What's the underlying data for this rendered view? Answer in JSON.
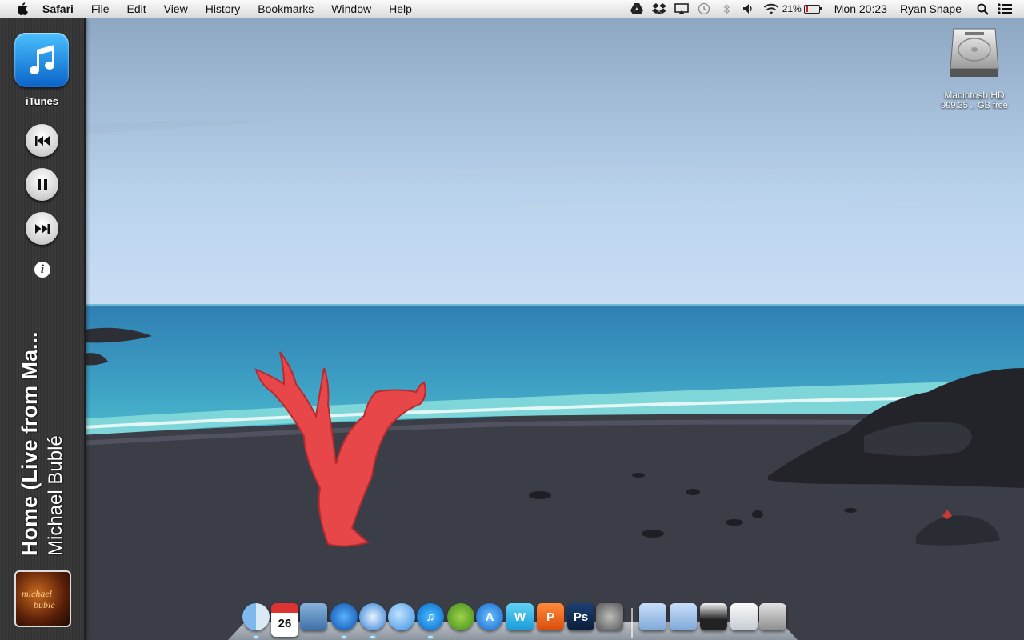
{
  "menubar": {
    "apple_icon": "apple-logo",
    "app_name": "Safari",
    "menus": [
      "File",
      "Edit",
      "View",
      "History",
      "Bookmarks",
      "Window",
      "Help"
    ],
    "status_icons": [
      "google-drive-icon",
      "dropbox-icon",
      "airplay-icon",
      "time-machine-icon",
      "bluetooth-icon",
      "volume-icon",
      "wifi-icon"
    ],
    "battery_percent": "21%",
    "battery_level": 0.21,
    "clock": "Mon 20:23",
    "user": "Ryan Snape",
    "search_icon": "spotlight-icon",
    "list_icon": "notification-center-icon"
  },
  "widget": {
    "app_label": "iTunes",
    "controls": [
      "previous-icon",
      "pause-icon",
      "next-icon",
      "info-icon"
    ],
    "info_glyph": "i",
    "song_title": "Home (Live from Ma...",
    "artist": "Michael Bublé",
    "album_art_text_1": "michael",
    "album_art_text_2": "bublé"
  },
  "desktop": {
    "drive_name": "Macintosh HD",
    "drive_free": "999.35 .. GB free"
  },
  "dock": {
    "items": [
      {
        "name": "finder",
        "glyph": ""
      },
      {
        "name": "calendar",
        "glyph": "26"
      },
      {
        "name": "preview",
        "glyph": ""
      },
      {
        "name": "team-viewer",
        "glyph": ""
      },
      {
        "name": "safari",
        "glyph": ""
      },
      {
        "name": "messages",
        "glyph": ""
      },
      {
        "name": "itunes",
        "glyph": "♫"
      },
      {
        "name": "spotify",
        "glyph": ""
      },
      {
        "name": "app-store",
        "glyph": "A"
      },
      {
        "name": "word",
        "glyph": "W"
      },
      {
        "name": "powerpoint",
        "glyph": "P"
      },
      {
        "name": "photoshop",
        "glyph": "Ps"
      },
      {
        "name": "system-preferences",
        "glyph": ""
      },
      {
        "name": "documents-folder",
        "glyph": ""
      },
      {
        "name": "applications-folder",
        "glyph": ""
      },
      {
        "name": "downloads-stack",
        "glyph": ""
      },
      {
        "name": "mail-stack",
        "glyph": ""
      },
      {
        "name": "trash",
        "glyph": ""
      }
    ]
  }
}
